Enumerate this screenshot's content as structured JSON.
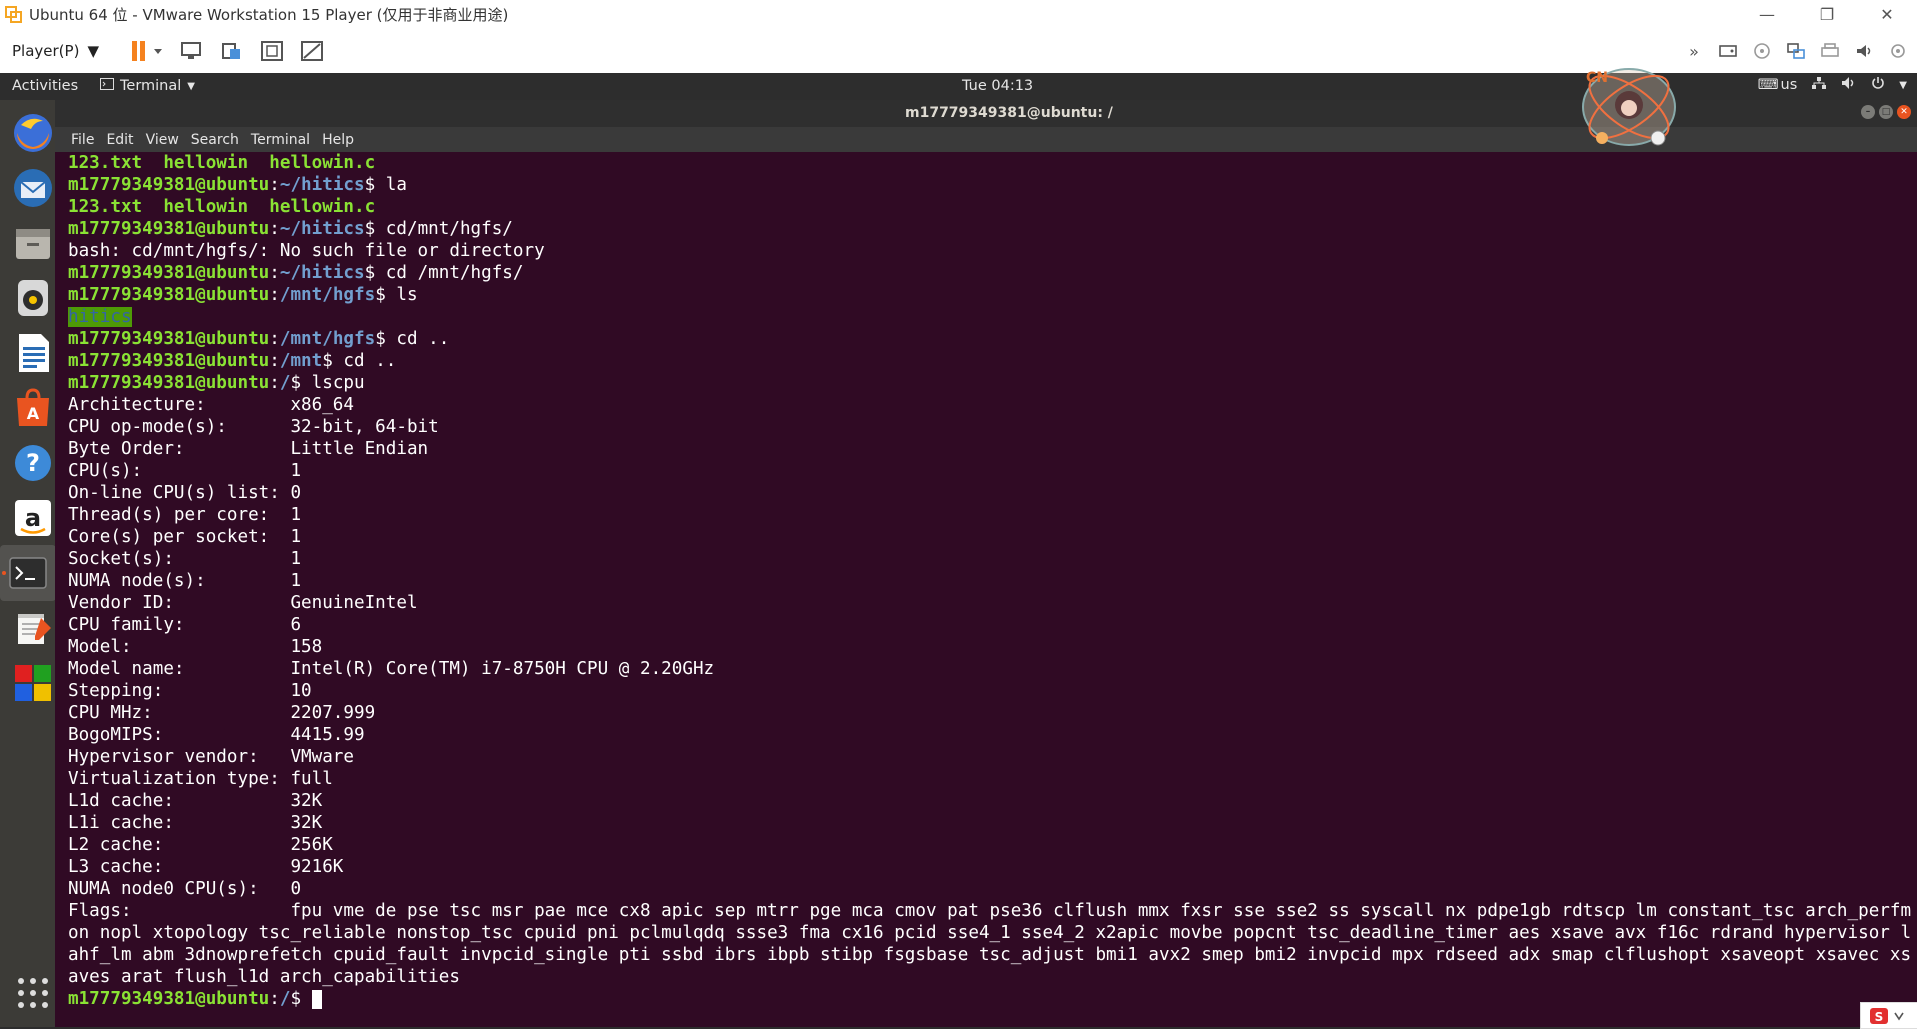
{
  "vmware": {
    "window_title": "Ubuntu 64 位 - VMware Workstation 15 Player (仅用于非商业用途)",
    "player_menu": "Player(P)",
    "colors": {
      "pause_orange": "#f5821f",
      "accent_orange": "#e95420"
    }
  },
  "ubuntu": {
    "activities": "Activities",
    "app_menu": "Terminal",
    "clock": "Tue 04:13",
    "keyboard_layout": "us"
  },
  "dock": {
    "items": [
      {
        "name": "firefox",
        "icon": "firefox-icon"
      },
      {
        "name": "thunderbird",
        "icon": "thunderbird-icon"
      },
      {
        "name": "files",
        "icon": "files-icon"
      },
      {
        "name": "rhythmbox",
        "icon": "rhythmbox-icon"
      },
      {
        "name": "libreoffice-writer",
        "icon": "writer-icon"
      },
      {
        "name": "software",
        "icon": "software-icon"
      },
      {
        "name": "help",
        "icon": "help-icon"
      },
      {
        "name": "amazon",
        "icon": "amazon-icon"
      },
      {
        "name": "terminal",
        "icon": "terminal-icon"
      },
      {
        "name": "text-editor",
        "icon": "text-editor-icon"
      },
      {
        "name": "app-grid",
        "icon": "app-grid-icon"
      }
    ]
  },
  "terminal": {
    "title": "m17779349381@ubuntu: /",
    "menu": [
      "File",
      "Edit",
      "View",
      "Search",
      "Terminal",
      "Help"
    ],
    "prompt_user": "m17779349381@ubuntu",
    "lines": {
      "l1": "123.txt  hellowin  hellowin.c",
      "l2_path": "~/hitics",
      "l2_cmd": "$ la",
      "l3": "123.txt  hellowin  hellowin.c",
      "l4_path": "~/hitics",
      "l4_cmd": "$ cd/mnt/hgfs/",
      "l5": "bash: cd/mnt/hgfs/: No such file or directory",
      "l6_path": "~/hitics",
      "l6_cmd": "$ cd /mnt/hgfs/",
      "l7_path": "/mnt/hgfs",
      "l7_cmd": "$ ls",
      "l8": "hitics",
      "l9_path": "/mnt/hgfs",
      "l9_cmd": "$ cd ..",
      "l10_path": "/mnt",
      "l10_cmd": "$ cd ..",
      "l11_path": "/",
      "l11_cmd": "$ lscpu",
      "final_path": "/",
      "final_cmd": "$ "
    },
    "lscpu": [
      "Architecture:        x86_64",
      "CPU op-mode(s):      32-bit, 64-bit",
      "Byte Order:          Little Endian",
      "CPU(s):              1",
      "On-line CPU(s) list: 0",
      "Thread(s) per core:  1",
      "Core(s) per socket:  1",
      "Socket(s):           1",
      "NUMA node(s):        1",
      "Vendor ID:           GenuineIntel",
      "CPU family:          6",
      "Model:               158",
      "Model name:          Intel(R) Core(TM) i7-8750H CPU @ 2.20GHz",
      "Stepping:            10",
      "CPU MHz:             2207.999",
      "BogoMIPS:            4415.99",
      "Hypervisor vendor:   VMware",
      "Virtualization type: full",
      "L1d cache:           32K",
      "L1i cache:           32K",
      "L2 cache:            256K",
      "L3 cache:            9216K",
      "NUMA node0 CPU(s):   0"
    ],
    "flags": "Flags:               fpu vme de pse tsc msr pae mce cx8 apic sep mtrr pge mca cmov pat pse36 clflush mmx fxsr sse sse2 ss syscall nx pdpe1gb rdtscp lm constant_tsc arch_perfmon nopl xtopology tsc_reliable nonstop_tsc cpuid pni pclmulqdq ssse3 fma cx16 pcid sse4_1 sse4_2 x2apic movbe popcnt tsc_deadline_timer aes xsave avx f16c rdrand hypervisor lahf_lm abm 3dnowprefetch cpuid_fault invpcid_single pti ssbd ibrs ibpb stibp fsgsbase tsc_adjust bmi1 avx2 smep bmi2 invpcid mpx rdseed adx smap clflushopt xsaveopt xsavec xsaves arat flush_l1d arch_capabilities",
    "colors": {
      "background": "#300a24",
      "user": "#8ae234",
      "path": "#729fcf"
    }
  },
  "overlay": {
    "badge_text": "CN"
  }
}
